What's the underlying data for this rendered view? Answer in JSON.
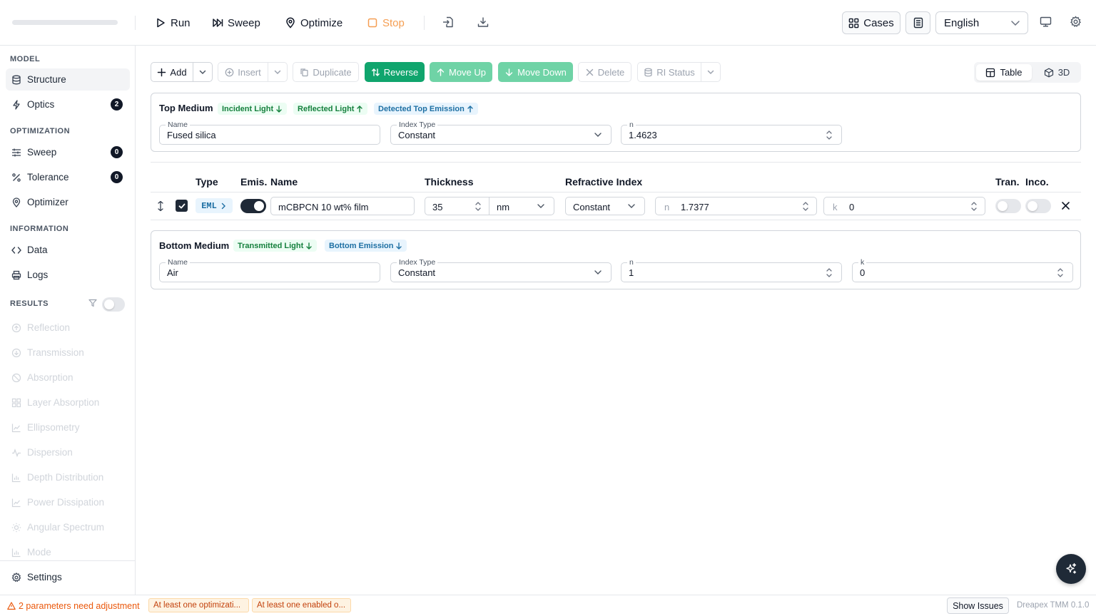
{
  "toolbar": {
    "run": "Run",
    "sweep": "Sweep",
    "optimize": "Optimize",
    "stop": "Stop",
    "cases": "Cases",
    "language": "English",
    "stop_color": "#f59e52"
  },
  "sidebar": {
    "section_model": "MODEL",
    "structure": "Structure",
    "optics": "Optics",
    "optics_badge": "2",
    "section_optimization": "OPTIMIZATION",
    "sweep": "Sweep",
    "sweep_badge": "0",
    "tolerance": "Tolerance",
    "tolerance_badge": "0",
    "optimizer": "Optimizer",
    "section_information": "INFORMATION",
    "data": "Data",
    "logs": "Logs",
    "section_results": "RESULTS",
    "results_toggle_on": false,
    "results": [
      {
        "label": "Reflection",
        "icon": "reflection-icon"
      },
      {
        "label": "Transmission",
        "icon": "transmission-icon"
      },
      {
        "label": "Absorption",
        "icon": "absorption-icon"
      },
      {
        "label": "Layer Absorption",
        "icon": "layer-absorption-icon"
      },
      {
        "label": "Ellipsometry",
        "icon": "chart-line-icon"
      },
      {
        "label": "Dispersion",
        "icon": "activity-icon"
      },
      {
        "label": "Depth Distribution",
        "icon": "bar-chart-icon"
      },
      {
        "label": "Power Dissipation",
        "icon": "chart-line-icon"
      },
      {
        "label": "Angular Spectrum",
        "icon": "sun-icon"
      },
      {
        "label": "Mode",
        "icon": "bar-chart-icon"
      }
    ],
    "settings": "Settings"
  },
  "actions": {
    "add": "Add",
    "insert": "Insert",
    "duplicate": "Duplicate",
    "reverse": "Reverse",
    "move_up": "Move Up",
    "move_down": "Move Down",
    "delete": "Delete",
    "ri_status": "RI Status",
    "view_table": "Table",
    "view_3d": "3D",
    "active_view": "Table"
  },
  "top_medium": {
    "title": "Top Medium",
    "tags": [
      {
        "label": "Incident Light",
        "arrow": "down",
        "color": "green"
      },
      {
        "label": "Reflected Light",
        "arrow": "up",
        "color": "green"
      },
      {
        "label": "Detected Top Emission",
        "arrow": "up",
        "color": "blue"
      }
    ],
    "name_label": "Name",
    "name": "Fused silica",
    "index_type_label": "Index Type",
    "index_type": "Constant",
    "n_label": "n",
    "n": "1.4623"
  },
  "layer_table": {
    "headers": {
      "type": "Type",
      "emis": "Emis.",
      "name": "Name",
      "thickness": "Thickness",
      "refractive_index": "Refractive Index",
      "tran": "Tran.",
      "inco": "Inco."
    },
    "rows": [
      {
        "checked": true,
        "type": "EML",
        "emissive": true,
        "name": "mCBPCN 10 wt% film",
        "thickness": "35",
        "unit": "nm",
        "index_type": "Constant",
        "n_prefix": "n",
        "n": "1.7377",
        "k_prefix": "k",
        "k": "0",
        "transparent": false,
        "incoherent": false
      }
    ]
  },
  "bottom_medium": {
    "title": "Bottom Medium",
    "tags": [
      {
        "label": "Transmitted Light",
        "arrow": "down",
        "color": "green"
      },
      {
        "label": "Bottom Emission",
        "arrow": "down",
        "color": "blue"
      }
    ],
    "name_label": "Name",
    "name": "Air",
    "index_type_label": "Index Type",
    "index_type": "Constant",
    "n_label": "n",
    "n": "1",
    "k_label": "k",
    "k": "0"
  },
  "status": {
    "warning": "2 parameters need adjustment",
    "chips": [
      "At least one optimizati...",
      "At least one enabled o..."
    ],
    "show_issues": "Show Issues",
    "version": "Dreapex TMM 0.1.0"
  },
  "colors": {
    "accent_green": "#10a56d",
    "light_green": "#6fd3a6",
    "warning_orange": "#ea580c"
  }
}
